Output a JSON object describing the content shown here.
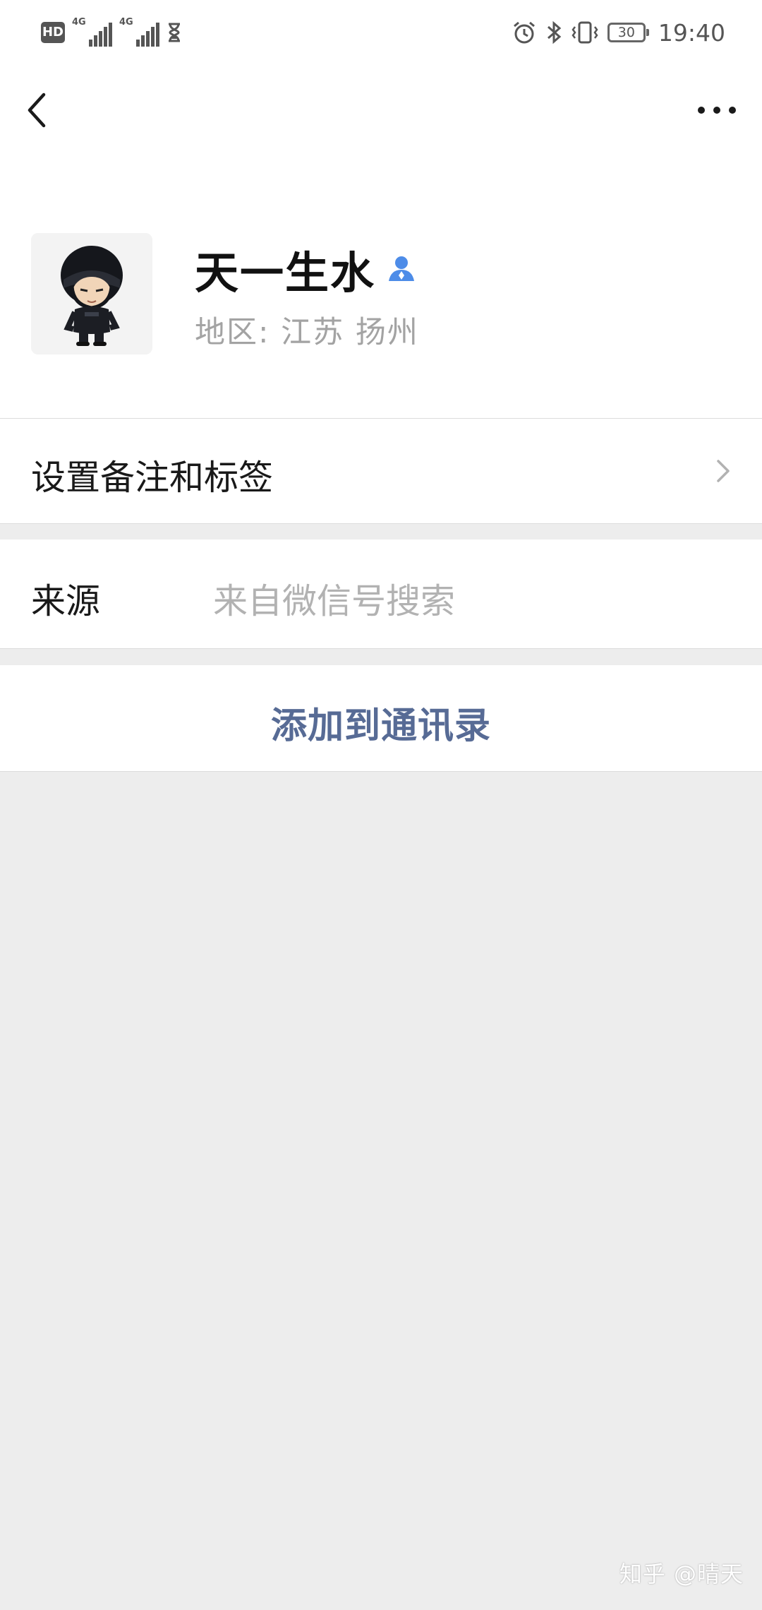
{
  "status_bar": {
    "hd_badge": "HD",
    "network_1": "4G",
    "network_2": "4G",
    "battery_level": "30",
    "time": "19:40"
  },
  "nav": {
    "back_icon": "chevron-left-icon",
    "more_icon": "more-horizontal-icon"
  },
  "profile": {
    "nickname": "天一生水",
    "region": "地区: 江苏  扬州",
    "badge_icon": "contact-person-icon",
    "badge_color": "#4d8ce8"
  },
  "rows": {
    "remark_label": "设置备注和标签",
    "source_label": "来源",
    "source_value": "来自微信号搜索",
    "add_button": "添加到通讯录"
  },
  "colors": {
    "link_blue": "#576b95",
    "background_gray": "#ededed"
  },
  "watermark": "知乎 @晴天"
}
